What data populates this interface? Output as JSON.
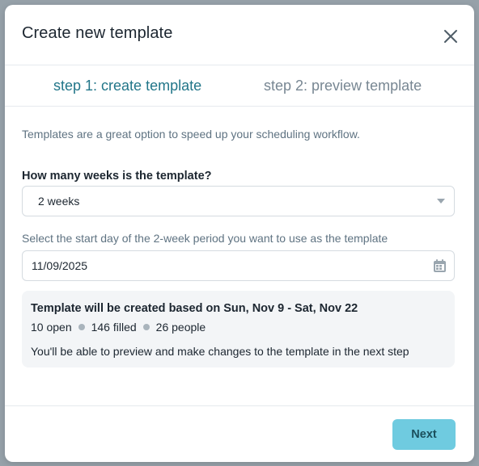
{
  "modal": {
    "title": "Create new template"
  },
  "tabs": [
    {
      "label": "step 1: create template",
      "active": true
    },
    {
      "label": "step 2: preview template",
      "active": false
    }
  ],
  "intro_text": "Templates are a great option to speed up your scheduling workflow.",
  "weeks_question": {
    "label": "How many weeks is the template?",
    "selected_value": "2 weeks"
  },
  "start_day": {
    "label": "Select the start day of the 2-week period you want to use as the template",
    "value": "11/09/2025"
  },
  "summary": {
    "title": "Template will be created based on Sun, Nov 9 - Sat, Nov 22",
    "open": "10 open",
    "filled": "146 filled",
    "people": "26 people",
    "note": "You'll be able to preview and make changes to the template in the next step"
  },
  "footer": {
    "next_label": "Next"
  },
  "colors": {
    "accent": "#227689",
    "button_bg": "#6fcbe0",
    "button_text": "#1b4f5c"
  }
}
